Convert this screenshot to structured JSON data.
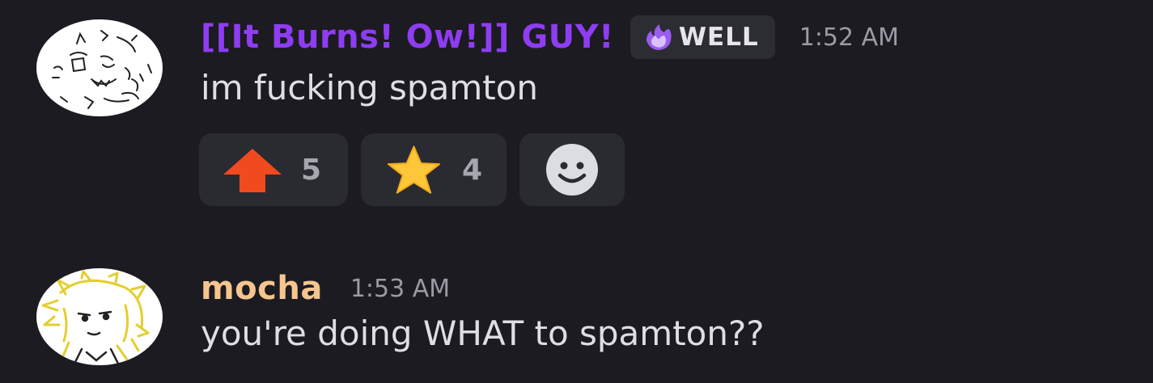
{
  "messages": [
    {
      "username": "[[It Burns! Ow!]] GUY!",
      "username_color": "#8e3df2",
      "badge": {
        "icon": "purple-flame-icon",
        "label": "WELL"
      },
      "timestamp": "1:52 AM",
      "text": "im fucking spamton",
      "reactions": [
        {
          "icon": "red-up-arrow-icon",
          "count": "5"
        },
        {
          "icon": "star-icon",
          "count": "4"
        }
      ],
      "add_reaction_icon": "smiley-add-reaction-icon"
    },
    {
      "username": "mocha",
      "username_color": "#f6c58e",
      "timestamp": "1:53 AM",
      "text": "you're doing WHAT to spamton??"
    }
  ],
  "colors": {
    "background": "#1c1b21",
    "reaction_bg": "#2a2a31",
    "badge_bg": "#2c2c33",
    "timestamp": "#9a9ba3"
  }
}
